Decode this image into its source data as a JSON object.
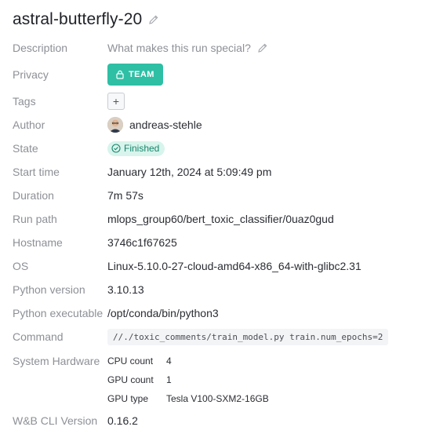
{
  "run": {
    "title": "astral-butterfly-20"
  },
  "fields": {
    "description": {
      "label": "Description",
      "placeholder": "What makes this run special?"
    },
    "privacy": {
      "label": "Privacy",
      "button": "TEAM"
    },
    "tags": {
      "label": "Tags",
      "add": "+"
    },
    "author": {
      "label": "Author",
      "value": "andreas-stehle"
    },
    "state": {
      "label": "State",
      "value": "Finished",
      "color": "#18856c"
    },
    "start_time": {
      "label": "Start time",
      "value": "January 12th, 2024 at 5:09:49 pm"
    },
    "duration": {
      "label": "Duration",
      "value": "7m 57s"
    },
    "run_path": {
      "label": "Run path",
      "value": "mlops_group60/bert_toxic_classifier/0uaz0gud"
    },
    "hostname": {
      "label": "Hostname",
      "value": "3746c1f67625"
    },
    "os": {
      "label": "OS",
      "value": "Linux-5.10.0-27-cloud-amd64-x86_64-with-glibc2.31"
    },
    "python_version": {
      "label": "Python version",
      "value": "3.10.13"
    },
    "python_executable": {
      "label": "Python executable",
      "value": "/opt/conda/bin/python3"
    },
    "command": {
      "label": "Command",
      "value": "<python with no main file> ../../toxic_comments/train_model.py train.num_epochs=2",
      "visible": "//./toxic_comments/train_model.py train.num_epochs=2"
    },
    "hardware": {
      "label": "System Hardware",
      "rows": [
        {
          "key": "CPU count",
          "value": "4"
        },
        {
          "key": "GPU count",
          "value": "1"
        },
        {
          "key": "GPU type",
          "value": "Tesla V100-SXM2-16GB"
        }
      ]
    },
    "cli_version": {
      "label": "W&B CLI Version",
      "value": "0.16.2"
    }
  },
  "icons": {
    "edit": "pencil-icon",
    "lock": "lock-icon",
    "check": "check-circle-icon"
  },
  "colors": {
    "accent": "#2ebfa5",
    "label": "#8d9096"
  }
}
